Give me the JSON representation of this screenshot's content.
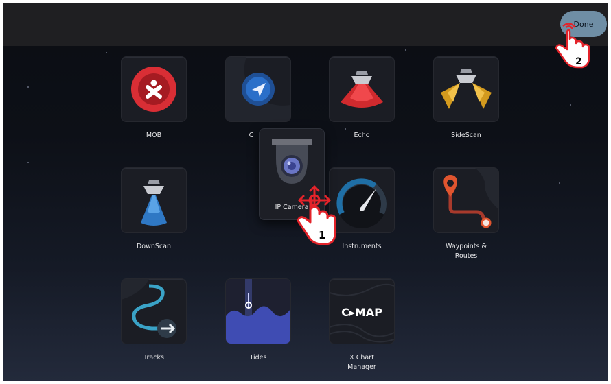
{
  "header": {
    "done_label": "Done"
  },
  "apps": [
    {
      "label": "MOB",
      "icon": "mob-icon"
    },
    {
      "label": "C",
      "icon": "chart-icon"
    },
    {
      "label": "Echo",
      "icon": "echo-icon"
    },
    {
      "label": "SideScan",
      "icon": "sidescan-icon"
    },
    {
      "label": "DownScan",
      "icon": "downscan-icon"
    },
    {
      "label": "Instruments",
      "icon": "instruments-icon"
    },
    {
      "label": "Waypoints &",
      "label2": "Routes",
      "icon": "waypoints-icon"
    },
    {
      "label": "Tracks",
      "icon": "tracks-icon"
    },
    {
      "label": "Tides",
      "icon": "tides-icon"
    },
    {
      "label": "X Chart",
      "label2": "Manager",
      "icon": "cmap-icon"
    }
  ],
  "dragging": {
    "label": "IP Camera",
    "icon": "ip-camera-icon"
  },
  "cmap_logo": "C▸MAP",
  "steps": [
    "1",
    "2"
  ],
  "colors": {
    "topbar": "#1f1f22",
    "done_button": "#6f8ea5",
    "accent_red": "#d92e35",
    "accent_blue": "#2a6fc9"
  }
}
